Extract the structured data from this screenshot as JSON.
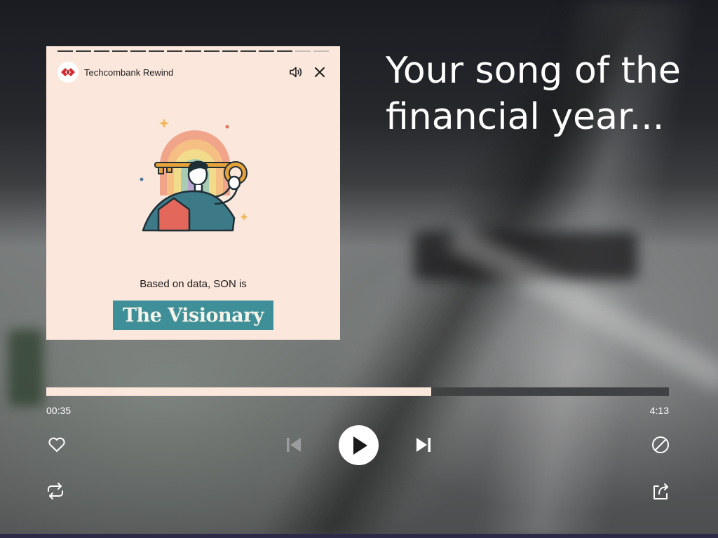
{
  "story": {
    "brand_name": "Techcombank Rewind",
    "progress": {
      "total_segments": 15,
      "completed_segments": 13
    },
    "based_text": "Based on data, SON is",
    "persona": "The Visionary",
    "icons": {
      "logo": "techcombank-logo-icon",
      "volume": "volume-icon",
      "close": "close-icon"
    }
  },
  "headline": "Your song of the financial year...",
  "player": {
    "elapsed": "00:35",
    "total": "4:13",
    "progress_fraction": 0.618,
    "icons": {
      "like": "heart-icon",
      "previous": "skip-previous-icon",
      "play": "play-icon",
      "next": "skip-next-icon",
      "block": "block-icon",
      "repeat": "repeat-icon",
      "share": "share-icon"
    }
  },
  "colors": {
    "card_bg": "#fbe7dc",
    "persona_bg": "#3e8f97",
    "brand_red": "#d62b32",
    "progress_fill": "#fbe7dc"
  }
}
